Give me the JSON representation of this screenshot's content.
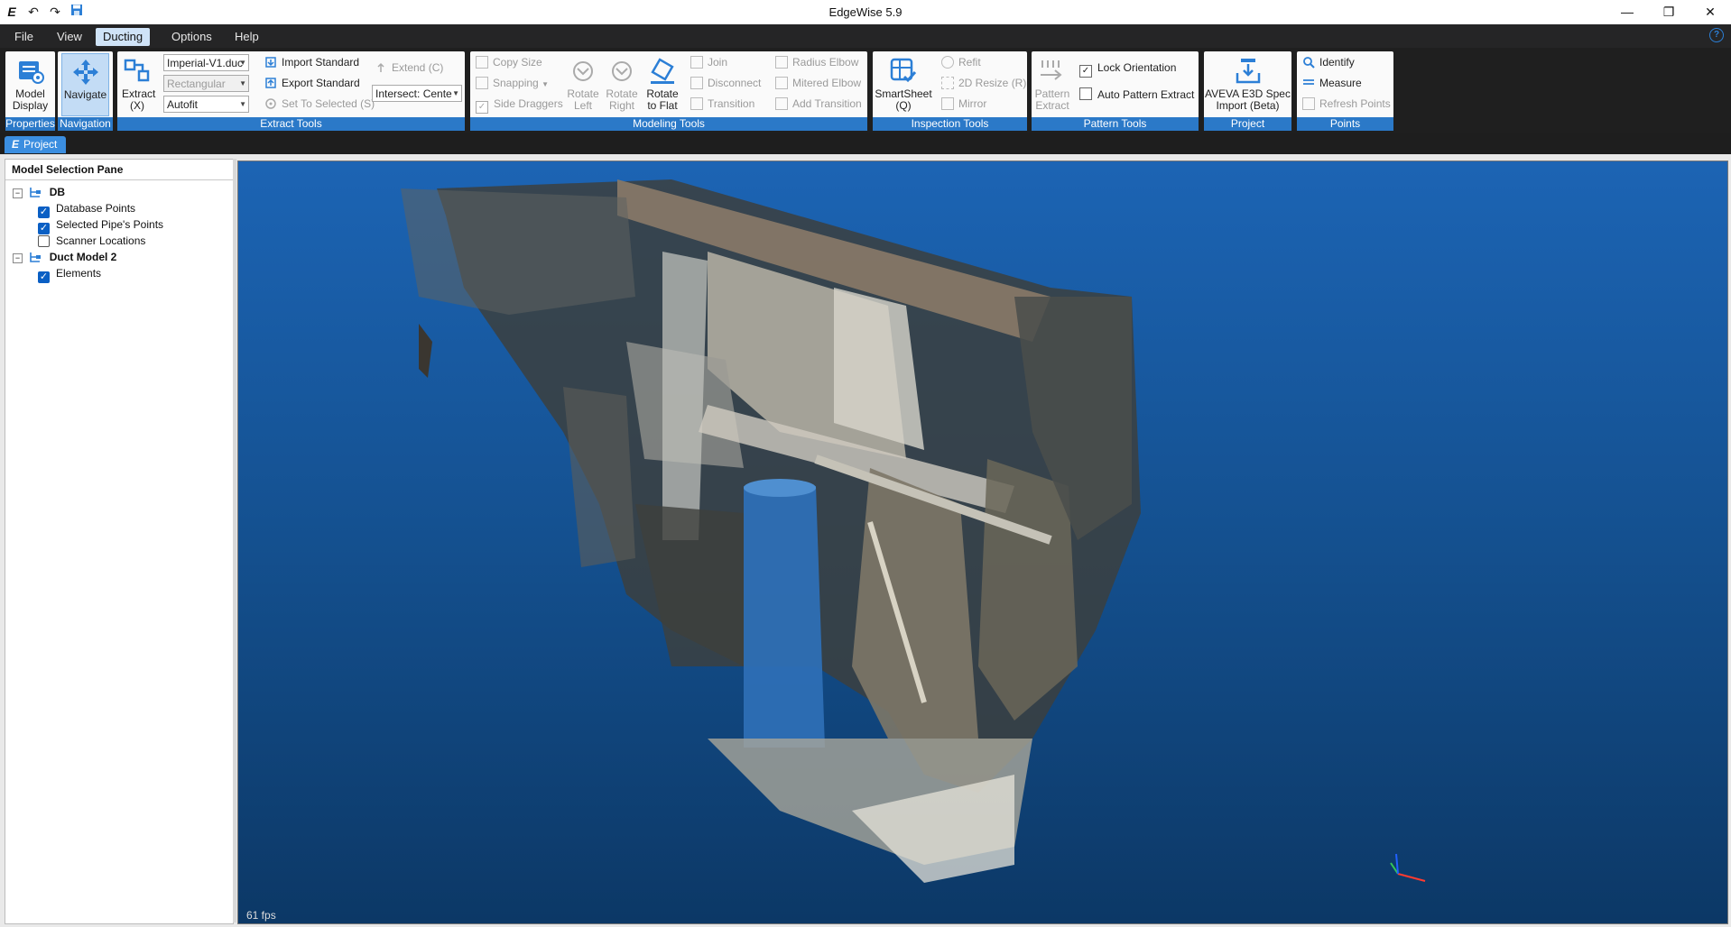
{
  "app": {
    "title": "EdgeWise 5.9"
  },
  "menu": {
    "file": "File",
    "view": "View",
    "ducting": "Ducting",
    "options": "Options",
    "help": "Help"
  },
  "ribbon": {
    "properties": {
      "label": "Properties",
      "model_display": "Model Display"
    },
    "navigation": {
      "label": "Navigation",
      "navigate": "Navigate"
    },
    "extract_tools": {
      "label": "Extract Tools",
      "extract": "Extract (X)",
      "standard_combo": "Imperial-V1.duc",
      "shape_combo": "Rectangular",
      "fit_combo": "Autofit",
      "import_standard": "Import Standard",
      "export_standard": "Export Standard",
      "set_to_selected": "Set To Selected (S)",
      "extend": "Extend (C)",
      "intersect_combo": "Intersect: Cente"
    },
    "modeling_tools": {
      "label": "Modeling Tools",
      "copy_size": "Copy Size",
      "snapping": "Snapping",
      "side_draggers": "Side Draggers",
      "rotate_left": "Rotate Left",
      "rotate_right": "Rotate Right",
      "rotate_to_flat": "Rotate to Flat",
      "join": "Join",
      "disconnect": "Disconnect",
      "transition": "Transition",
      "radius_elbow": "Radius Elbow",
      "mitered_elbow": "Mitered Elbow",
      "add_transition": "Add Transition"
    },
    "inspection_tools": {
      "label": "Inspection Tools",
      "smartsheet": "SmartSheet (Q)",
      "refit": "Refit",
      "resize_2d": "2D Resize (R)",
      "mirror": "Mirror"
    },
    "pattern_tools": {
      "label": "Pattern Tools",
      "pattern_extract": "Pattern Extract",
      "lock_orientation": "Lock Orientation",
      "auto_pattern_extract": "Auto Pattern Extract"
    },
    "project": {
      "label": "Project",
      "aveva_line1": "AVEVA E3D Spec",
      "aveva_line2": "Import (Beta)"
    },
    "points": {
      "label": "Points",
      "identify": "Identify",
      "measure": "Measure",
      "refresh_points": "Refresh Points"
    }
  },
  "tabs": {
    "project": "Project"
  },
  "pane": {
    "title": "Model Selection Pane",
    "tree": [
      {
        "label": "DB",
        "checked": null
      },
      {
        "label": "Database Points",
        "checked": true
      },
      {
        "label": "Selected Pipe's Points",
        "checked": true
      },
      {
        "label": "Scanner Locations",
        "checked": false
      },
      {
        "label": "Duct Model 2",
        "checked": null
      },
      {
        "label": "Elements",
        "checked": true
      }
    ]
  },
  "viewport": {
    "fps": "61 fps"
  },
  "colors": {
    "accent": "#2b79c8",
    "viewport_top": "#1c64b4",
    "viewport_bottom": "#0c3866",
    "checked": "#0a5fc4"
  }
}
